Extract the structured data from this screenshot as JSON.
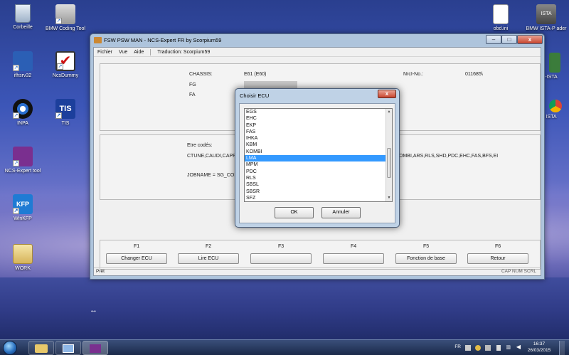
{
  "desktop": {
    "icons": [
      {
        "label": "Corbeille",
        "icon": "recycle-bin-icon"
      },
      {
        "label": "BMW Coding Tool",
        "icon": "bmw-coding-tool-icon"
      },
      {
        "label": "ifhsrv32",
        "icon": "ifhsrv32-icon"
      },
      {
        "label": "NcsDummy",
        "icon": "ncsdummy-icon"
      },
      {
        "label": "INPA",
        "icon": "inpa-icon"
      },
      {
        "label": "TIS",
        "icon": "tis-icon"
      },
      {
        "label": "NCS-Expert tool",
        "icon": "ncs-expert-icon"
      },
      {
        "label": "WinKFP",
        "icon": "winkfp-icon"
      },
      {
        "label": "WORK",
        "icon": "folder-icon"
      },
      {
        "label": "obd.ini",
        "icon": "ini-file-icon"
      },
      {
        "label": "BMW ISTA-P ader",
        "icon": "ista-p-icon"
      },
      {
        "label": "-ISTA",
        "icon": "ista-icon"
      },
      {
        "label": "ISTA",
        "icon": "chrome-ista-icon"
      }
    ]
  },
  "window": {
    "title": "FSW PSW MAN - NCS-Expert FR by Scorpium59",
    "menu": [
      "Fichier",
      "Vue",
      "Aide"
    ],
    "translation": "Traduction: Scorpium59",
    "info": {
      "chassis_label": "CHASSIS:",
      "chassis_value": "E61 (E60)",
      "fg_label": "FG",
      "fa_label": "FA",
      "nrcl_label": "NrcI-No.:",
      "nrcl_value": "011685\\"
    },
    "codage": {
      "label": "Etre codés:",
      "line1_left": "CTUNE,CAUDI,CAPPL",
      "line1_right": "OMBI,ARS,RLS,SHD,PDC,EHC,FAS,BFS,EI",
      "jobname": "JOBNAME = SG_CODIE"
    },
    "fkeys": [
      {
        "key": "F1",
        "label": "Changer ECU"
      },
      {
        "key": "F2",
        "label": "Lire ECU"
      },
      {
        "key": "F3",
        "label": ""
      },
      {
        "key": "F4",
        "label": ""
      },
      {
        "key": "F5",
        "label": "Fonction de base"
      },
      {
        "key": "F6",
        "label": "Retour"
      }
    ],
    "status": {
      "left": "Prêt",
      "right": "CAP  NUM  SCRL"
    }
  },
  "dialog": {
    "title": "Choisir ECU",
    "items": [
      "EGS",
      "EHC",
      "EKP",
      "FAS",
      "IHKA",
      "KBM",
      "KOMBI",
      "LMA",
      "MPM",
      "PDC",
      "RLS",
      "SBSL",
      "SBSR",
      "SFZ"
    ],
    "selected": "LMA",
    "ok": "OK",
    "cancel": "Annuler"
  },
  "taskbar": {
    "lang": "FR",
    "time": "16:37",
    "date": "26/03/2015"
  }
}
